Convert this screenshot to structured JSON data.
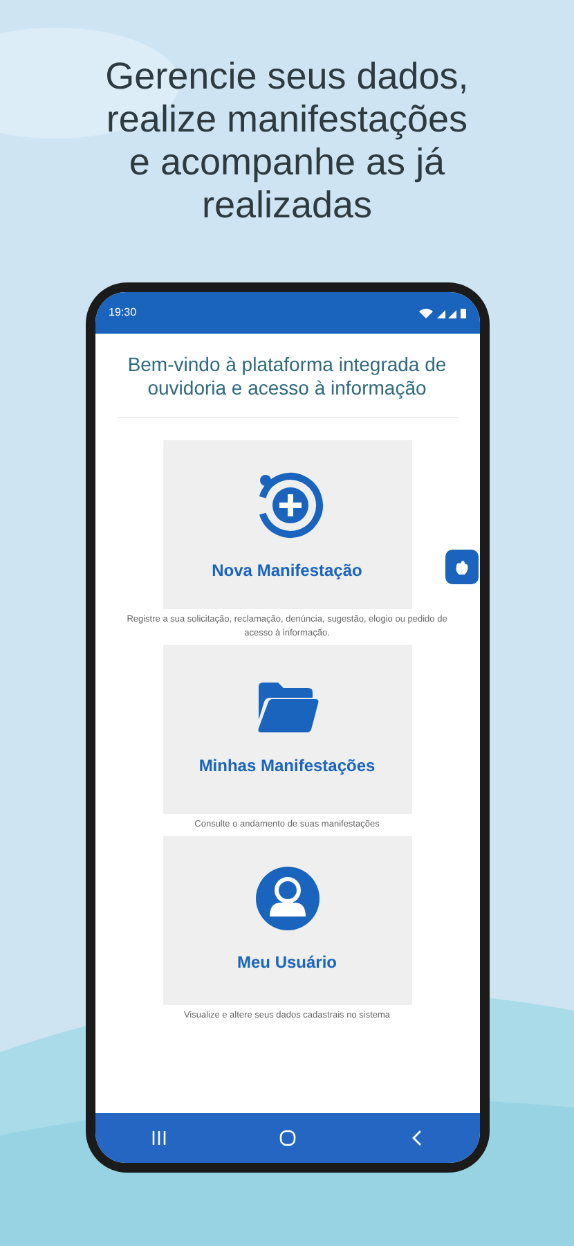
{
  "headline": "Gerencie seus dados, realize manifestações e acompanhe as já realizadas",
  "status_bar": {
    "time": "19:30"
  },
  "welcome": "Bem-vindo à plataforma integrada de ouvidoria e acesso à informação",
  "cards": [
    {
      "kind": "new",
      "title": "Nova Manifestação",
      "description": "Registre a sua solicitação, reclamação, denúncia, sugestão, elogio ou pedido de acesso à informação."
    },
    {
      "kind": "folder",
      "title": "Minhas Manifestações",
      "description": "Consulte o andamento de suas manifestações"
    },
    {
      "kind": "user",
      "title": "Meu Usuário",
      "description": "Visualize e altere seus dados cadastrais no sistema"
    }
  ]
}
